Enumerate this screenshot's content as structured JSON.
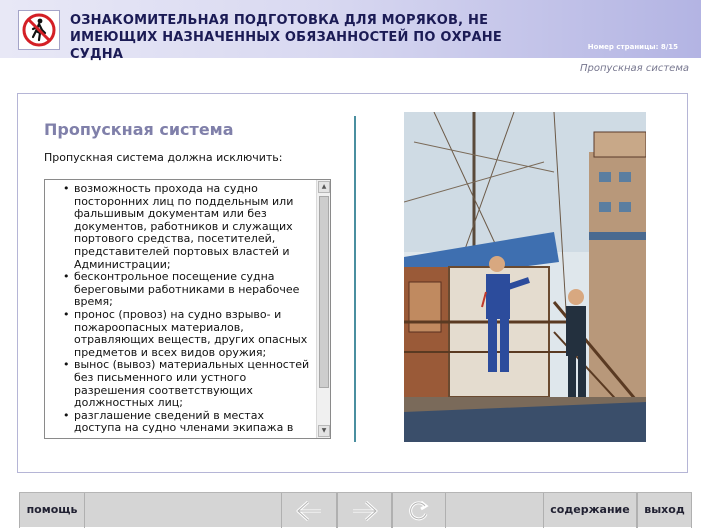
{
  "header": {
    "logo_icon": "no-pedestrian-sign-icon",
    "title": "ОЗНАКОМИТЕЛЬНАЯ ПОДГОТОВКА ДЛЯ МОРЯКОВ, НЕ ИМЕЮЩИХ НАЗНАЧЕННЫХ ОБЯЗАННОСТЕЙ ПО ОХРАНЕ СУДНА",
    "page_number": "Номер страницы: 8/15"
  },
  "section_caption": "Пропускная система",
  "content": {
    "title": "Пропускная система",
    "intro": "Пропускная система должна исключить:",
    "items": [
      "возможность прохода на судно посторонних лиц по поддельным или фальшивым документам или без документов, работников и служащих портового средства, посетителей, представителей портовых властей и Администрации;",
      "бесконтрольное посещение судна береговыми работниками в нерабочее время;",
      "пронос (провоз) на судно взрыво- и пожароопасных материалов, отравляющих веществ, других опасных предметов и всех видов оружия;",
      "вынос (вывоз) материальных ценностей без письменного или устного разрешения соответствующих должностных лиц;",
      "разглашение сведений в местах доступа на судно членами экипажа в отношении"
    ],
    "illustration_icon": "ship-gangway-illustration"
  },
  "nav": {
    "help": "помощь",
    "back_icon": "arrow-left-icon",
    "forward_icon": "arrow-right-icon",
    "reload_icon": "reload-icon",
    "contents": "содержание",
    "exit": "выход"
  },
  "colors": {
    "title_text": "#1b1b55",
    "content_title": "#8080aa",
    "divider": "#4a8fa0",
    "nav_bar": "#d5d5d5"
  }
}
